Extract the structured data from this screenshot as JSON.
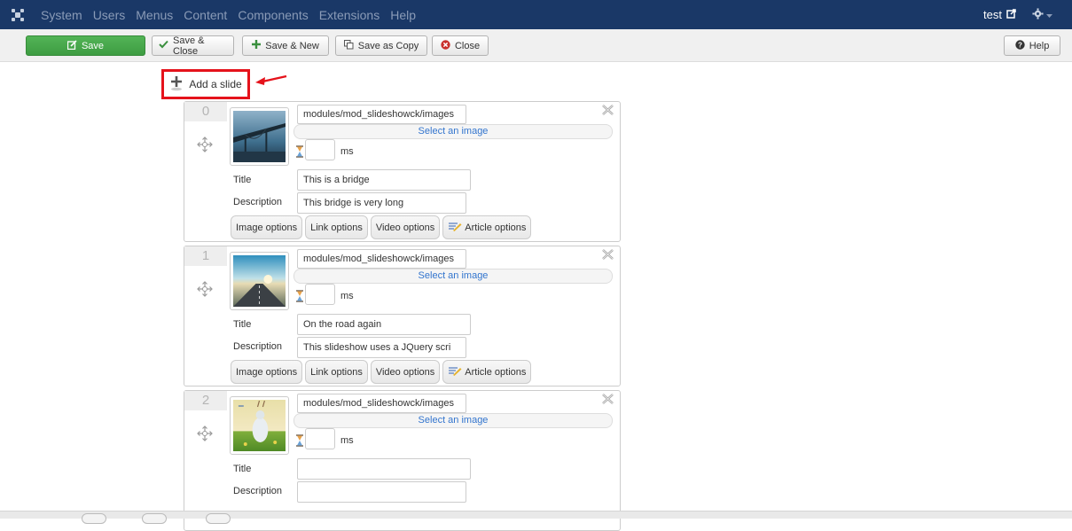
{
  "navbar": {
    "menu": [
      "System",
      "Users",
      "Menus",
      "Content",
      "Components",
      "Extensions",
      "Help"
    ],
    "user": "test"
  },
  "toolbar": {
    "save": "Save",
    "save_close": "Save & Close",
    "save_new": "Save & New",
    "save_copy": "Save as Copy",
    "close": "Close",
    "help": "Help"
  },
  "add_slide": "Add a slide",
  "common": {
    "select_image": "Select an image",
    "ms": "ms",
    "title_label": "Title",
    "description_label": "Description",
    "options": [
      "Image options",
      "Link options",
      "Video options",
      "Article options"
    ]
  },
  "slides": [
    {
      "number": "0",
      "path": "modules/mod_slideshowck/images",
      "title": "This is a bridge",
      "description": "This bridge is very long"
    },
    {
      "number": "1",
      "path": "modules/mod_slideshowck/images",
      "title": "On the road again",
      "description": "This slideshow uses a JQuery scri"
    },
    {
      "number": "2",
      "path": "modules/mod_slideshowck/images",
      "title": "",
      "description": ""
    }
  ]
}
